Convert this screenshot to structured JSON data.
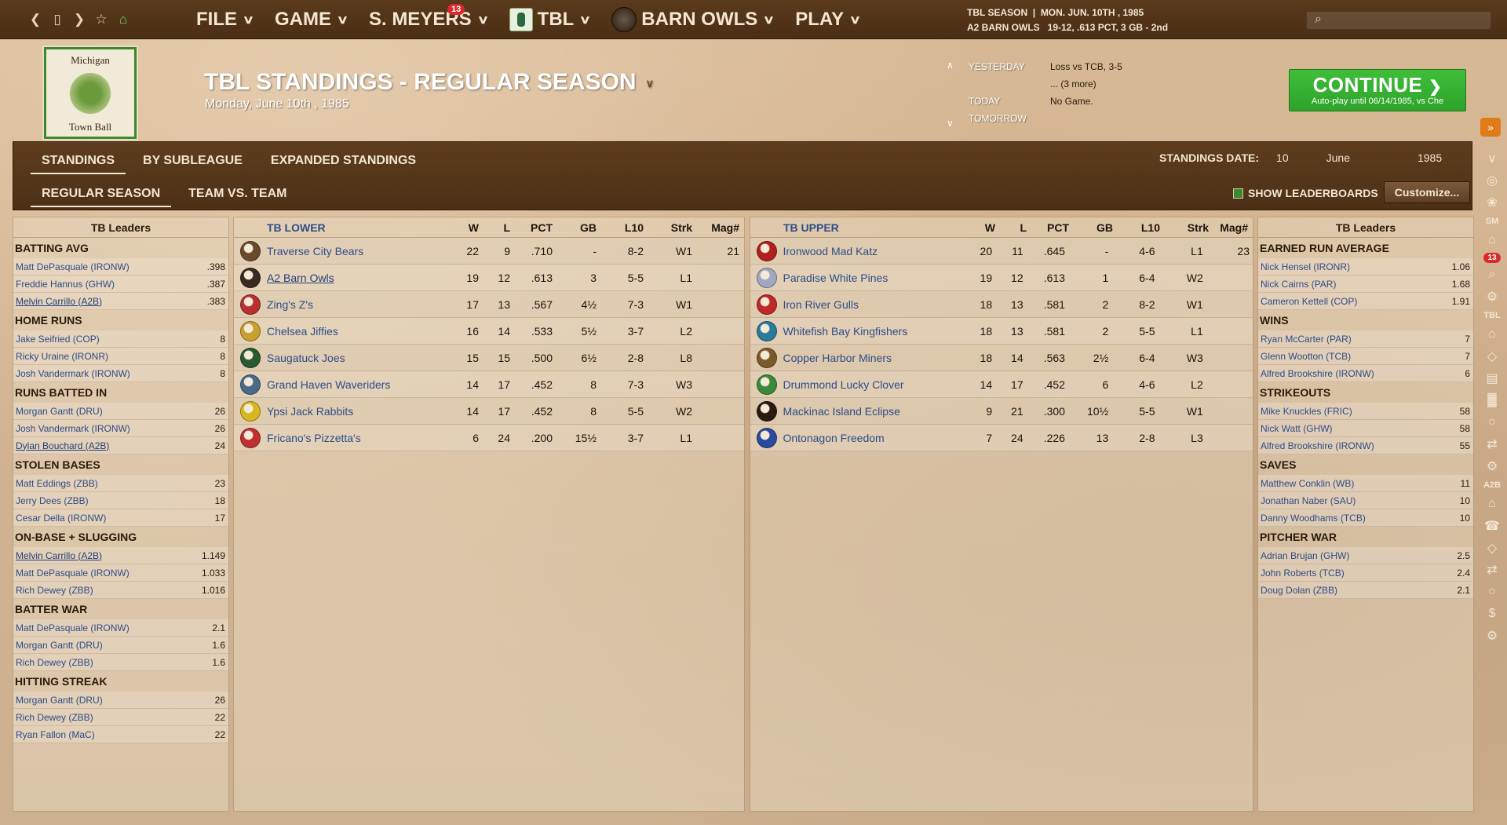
{
  "topbar": {
    "menus": [
      {
        "label": "FILE"
      },
      {
        "label": "GAME"
      },
      {
        "label": "S. MEYERS",
        "badge": "13"
      },
      {
        "label": "TBL"
      },
      {
        "label": "BARN OWLS"
      },
      {
        "label": "PLAY"
      }
    ],
    "season_line1": "TBL SEASON  |  MON. JUN. 10TH , 1985",
    "season_line2": "A2 BARN OWLS   19-12, .613 PCT, 3 GB - 2nd"
  },
  "header": {
    "logo_top": "Michigan",
    "logo_bottom": "Town Ball",
    "title": "TBL STANDINGS - REGULAR SEASON",
    "date": "Monday, June 10th , 1985",
    "schedule": [
      {
        "label": "YESTERDAY",
        "value": "Loss vs TCB, 3-5"
      },
      {
        "label": "",
        "value": "... (3 more)"
      },
      {
        "label": "TODAY",
        "value": "No Game."
      },
      {
        "label": "TOMORROW",
        "value": ""
      }
    ],
    "continue_label": "CONTINUE",
    "continue_sub": "Auto-play until 06/14/1985, vs Che"
  },
  "tabs": {
    "row1": [
      "STANDINGS",
      "BY SUBLEAGUE",
      "EXPANDED STANDINGS"
    ],
    "row2": [
      "REGULAR SEASON",
      "TEAM VS. TEAM"
    ],
    "standings_date_label": "STANDINGS DATE:",
    "date_day": "10",
    "date_month": "June",
    "date_year": "1985",
    "show_leaderboards": "SHOW LEADERBOARDS",
    "customize": "Customize..."
  },
  "left_leaders": {
    "title": "TB Leaders",
    "cats": [
      {
        "name": "BATTING AVG",
        "rows": [
          [
            "Matt DePasquale (IRONW)",
            ".398"
          ],
          [
            "Freddie Hannus (GHW)",
            ".387"
          ],
          [
            "Melvin Carrillo (A2B)",
            ".383"
          ]
        ]
      },
      {
        "name": "HOME RUNS",
        "rows": [
          [
            "Jake Seifried (COP)",
            "8"
          ],
          [
            "Ricky Uraine (IRONR)",
            "8"
          ],
          [
            "Josh Vandermark (IRONW)",
            "8"
          ]
        ]
      },
      {
        "name": "RUNS BATTED IN",
        "rows": [
          [
            "Morgan Gantt (DRU)",
            "26"
          ],
          [
            "Josh Vandermark (IRONW)",
            "26"
          ],
          [
            "Dylan Bouchard (A2B)",
            "24"
          ]
        ]
      },
      {
        "name": "STOLEN BASES",
        "rows": [
          [
            "Matt Eddings (ZBB)",
            "23"
          ],
          [
            "Jerry Dees (ZBB)",
            "18"
          ],
          [
            "Cesar Della (IRONW)",
            "17"
          ]
        ]
      },
      {
        "name": "ON-BASE + SLUGGING",
        "rows": [
          [
            "Melvin Carrillo (A2B)",
            "1.149"
          ],
          [
            "Matt DePasquale (IRONW)",
            "1.033"
          ],
          [
            "Rich Dewey (ZBB)",
            "1.016"
          ]
        ]
      },
      {
        "name": "BATTER WAR",
        "rows": [
          [
            "Matt DePasquale (IRONW)",
            "2.1"
          ],
          [
            "Morgan Gantt (DRU)",
            "1.6"
          ],
          [
            "Rich Dewey (ZBB)",
            "1.6"
          ]
        ]
      },
      {
        "name": "HITTING STREAK",
        "rows": [
          [
            "Morgan Gantt (DRU)",
            "26"
          ],
          [
            "Rich Dewey (ZBB)",
            "22"
          ],
          [
            "Ryan Fallon (MaC)",
            "22"
          ]
        ]
      }
    ]
  },
  "right_leaders": {
    "title": "TB Leaders",
    "cats": [
      {
        "name": "EARNED RUN AVERAGE",
        "rows": [
          [
            "Nick Hensel (IRONR)",
            "1.06"
          ],
          [
            "Nick Cairns (PAR)",
            "1.68"
          ],
          [
            "Cameron Kettell (COP)",
            "1.91"
          ]
        ]
      },
      {
        "name": "WINS",
        "rows": [
          [
            "Ryan McCarter (PAR)",
            "7"
          ],
          [
            "Glenn Wootton (TCB)",
            "7"
          ],
          [
            "Alfred Brookshire (IRONW)",
            "6"
          ]
        ]
      },
      {
        "name": "STRIKEOUTS",
        "rows": [
          [
            "Mike Knuckles (FRIC)",
            "58"
          ],
          [
            "Nick Watt (GHW)",
            "58"
          ],
          [
            "Alfred Brookshire (IRONW)",
            "55"
          ]
        ]
      },
      {
        "name": "SAVES",
        "rows": [
          [
            "Matthew Conklin (WB)",
            "11"
          ],
          [
            "Jonathan Naber (SAU)",
            "10"
          ],
          [
            "Danny Woodhams (TCB)",
            "10"
          ]
        ]
      },
      {
        "name": "PITCHER WAR",
        "rows": [
          [
            "Adrian Brujan (GHW)",
            "2.5"
          ],
          [
            "John Roberts (TCB)",
            "2.4"
          ],
          [
            "Doug Dolan (ZBB)",
            "2.1"
          ]
        ]
      }
    ]
  },
  "columns": [
    "W",
    "L",
    "PCT",
    "GB",
    "L10",
    "Strk",
    "Mag#"
  ],
  "tb_lower": {
    "title": "TB LOWER",
    "teams": [
      {
        "name": "Traverse City Bears",
        "w": "22",
        "l": "9",
        "pct": ".710",
        "gb": "-",
        "l10": "8-2",
        "strk": "W1",
        "mag": "21",
        "color": "#6b4a2a"
      },
      {
        "name": "A2 Barn Owls",
        "w": "19",
        "l": "12",
        "pct": ".613",
        "gb": "3",
        "l10": "5-5",
        "strk": "L1",
        "mag": "",
        "color": "#3a2a20"
      },
      {
        "name": "Zing's Z's",
        "w": "17",
        "l": "13",
        "pct": ".567",
        "gb": "4½",
        "l10": "7-3",
        "strk": "W1",
        "mag": "",
        "color": "#b83030"
      },
      {
        "name": "Chelsea Jiffies",
        "w": "16",
        "l": "14",
        "pct": ".533",
        "gb": "5½",
        "l10": "3-7",
        "strk": "L2",
        "mag": "",
        "color": "#c8a030"
      },
      {
        "name": "Saugatuck Joes",
        "w": "15",
        "l": "15",
        "pct": ".500",
        "gb": "6½",
        "l10": "2-8",
        "strk": "L8",
        "mag": "",
        "color": "#2a5a30"
      },
      {
        "name": "Grand Haven Waveriders",
        "w": "14",
        "l": "17",
        "pct": ".452",
        "gb": "8",
        "l10": "7-3",
        "strk": "W3",
        "mag": "",
        "color": "#4a6a8a"
      },
      {
        "name": "Ypsi Jack Rabbits",
        "w": "14",
        "l": "17",
        "pct": ".452",
        "gb": "8",
        "l10": "5-5",
        "strk": "W2",
        "mag": "",
        "color": "#d8b820"
      },
      {
        "name": "Fricano's Pizzetta's",
        "w": "6",
        "l": "24",
        "pct": ".200",
        "gb": "15½",
        "l10": "3-7",
        "strk": "L1",
        "mag": "",
        "color": "#c03030"
      }
    ]
  },
  "tb_upper": {
    "title": "TB UPPER",
    "teams": [
      {
        "name": "Ironwood Mad Katz",
        "w": "20",
        "l": "11",
        "pct": ".645",
        "gb": "-",
        "l10": "4-6",
        "strk": "L1",
        "mag": "23",
        "color": "#b02020"
      },
      {
        "name": "Paradise White Pines",
        "w": "19",
        "l": "12",
        "pct": ".613",
        "gb": "1",
        "l10": "6-4",
        "strk": "W2",
        "mag": "",
        "color": "#a0a8c0"
      },
      {
        "name": "Iron River Gulls",
        "w": "18",
        "l": "13",
        "pct": ".581",
        "gb": "2",
        "l10": "8-2",
        "strk": "W1",
        "mag": "",
        "color": "#c02828"
      },
      {
        "name": "Whitefish Bay Kingfishers",
        "w": "18",
        "l": "13",
        "pct": ".581",
        "gb": "2",
        "l10": "5-5",
        "strk": "L1",
        "mag": "",
        "color": "#2a7a9a"
      },
      {
        "name": "Copper Harbor Miners",
        "w": "18",
        "l": "14",
        "pct": ".563",
        "gb": "2½",
        "l10": "6-4",
        "strk": "W3",
        "mag": "",
        "color": "#7a5a2a"
      },
      {
        "name": "Drummond Lucky Clover",
        "w": "14",
        "l": "17",
        "pct": ".452",
        "gb": "6",
        "l10": "4-6",
        "strk": "L2",
        "mag": "",
        "color": "#3a8a3a"
      },
      {
        "name": "Mackinac Island Eclipse",
        "w": "9",
        "l": "21",
        "pct": ".300",
        "gb": "10½",
        "l10": "5-5",
        "strk": "W1",
        "mag": "",
        "color": "#2a1a10"
      },
      {
        "name": "Ontonagon Freedom",
        "w": "7",
        "l": "24",
        "pct": ".226",
        "gb": "13",
        "l10": "2-8",
        "strk": "L3",
        "mag": "",
        "color": "#2a4aa0"
      }
    ]
  },
  "right_rail": [
    "SM",
    "13",
    "TBL",
    "A2B"
  ]
}
